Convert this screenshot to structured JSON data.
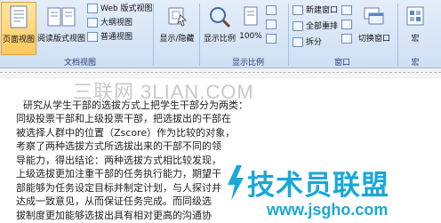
{
  "ribbon": {
    "view_group": {
      "page_view_label": "页面视图",
      "reading_view_label": "阅读版式视图",
      "web_view_label": "Web 版式视图",
      "outline_label": "大纲视图",
      "draft_label": "普通视图",
      "group_label": "文档视图"
    },
    "show_hide_label": "显示/隐藏",
    "zoom_group": {
      "zoom_label": "显示比例",
      "percent_label": "100%",
      "group_label": "显示比例"
    },
    "window_group": {
      "new_window_label": "新建窗口",
      "arrange_all_label": "全部重排",
      "split_label": "拆分",
      "switch_window_label": "切换窗口",
      "group_label": "窗口"
    },
    "macro_group": {
      "macro_label": "宏",
      "group_label": "宏"
    }
  },
  "document": {
    "lines": [
      "研究从学生干部的选拔方式上把学生干部分为两类：",
      "同级投票干部和上级投票干部，把选拔出的干部在",
      "被选择人群中的位置（Zscore）作为比较的对象，",
      "考察了两种选拔方式所选拔出来的干部不同的领",
      "导能力，得出结论：两种选拔方式相比较发现，",
      "上级选拔更加注重干部的任务执行能力，期望干",
      "部能够为任务设定目标并制定计划，与人探讨并",
      "达成一致意见，从而保证任务完成。而同级选",
      "拔制度更加能够选拔出具有相对更高的沟通协"
    ]
  },
  "watermarks": {
    "top_text": "三联网 3LIAN.COM",
    "brand_text": "技术员联盟",
    "brand_url": "www.jsgho.com",
    "brand_color": "#1aa7d8"
  }
}
